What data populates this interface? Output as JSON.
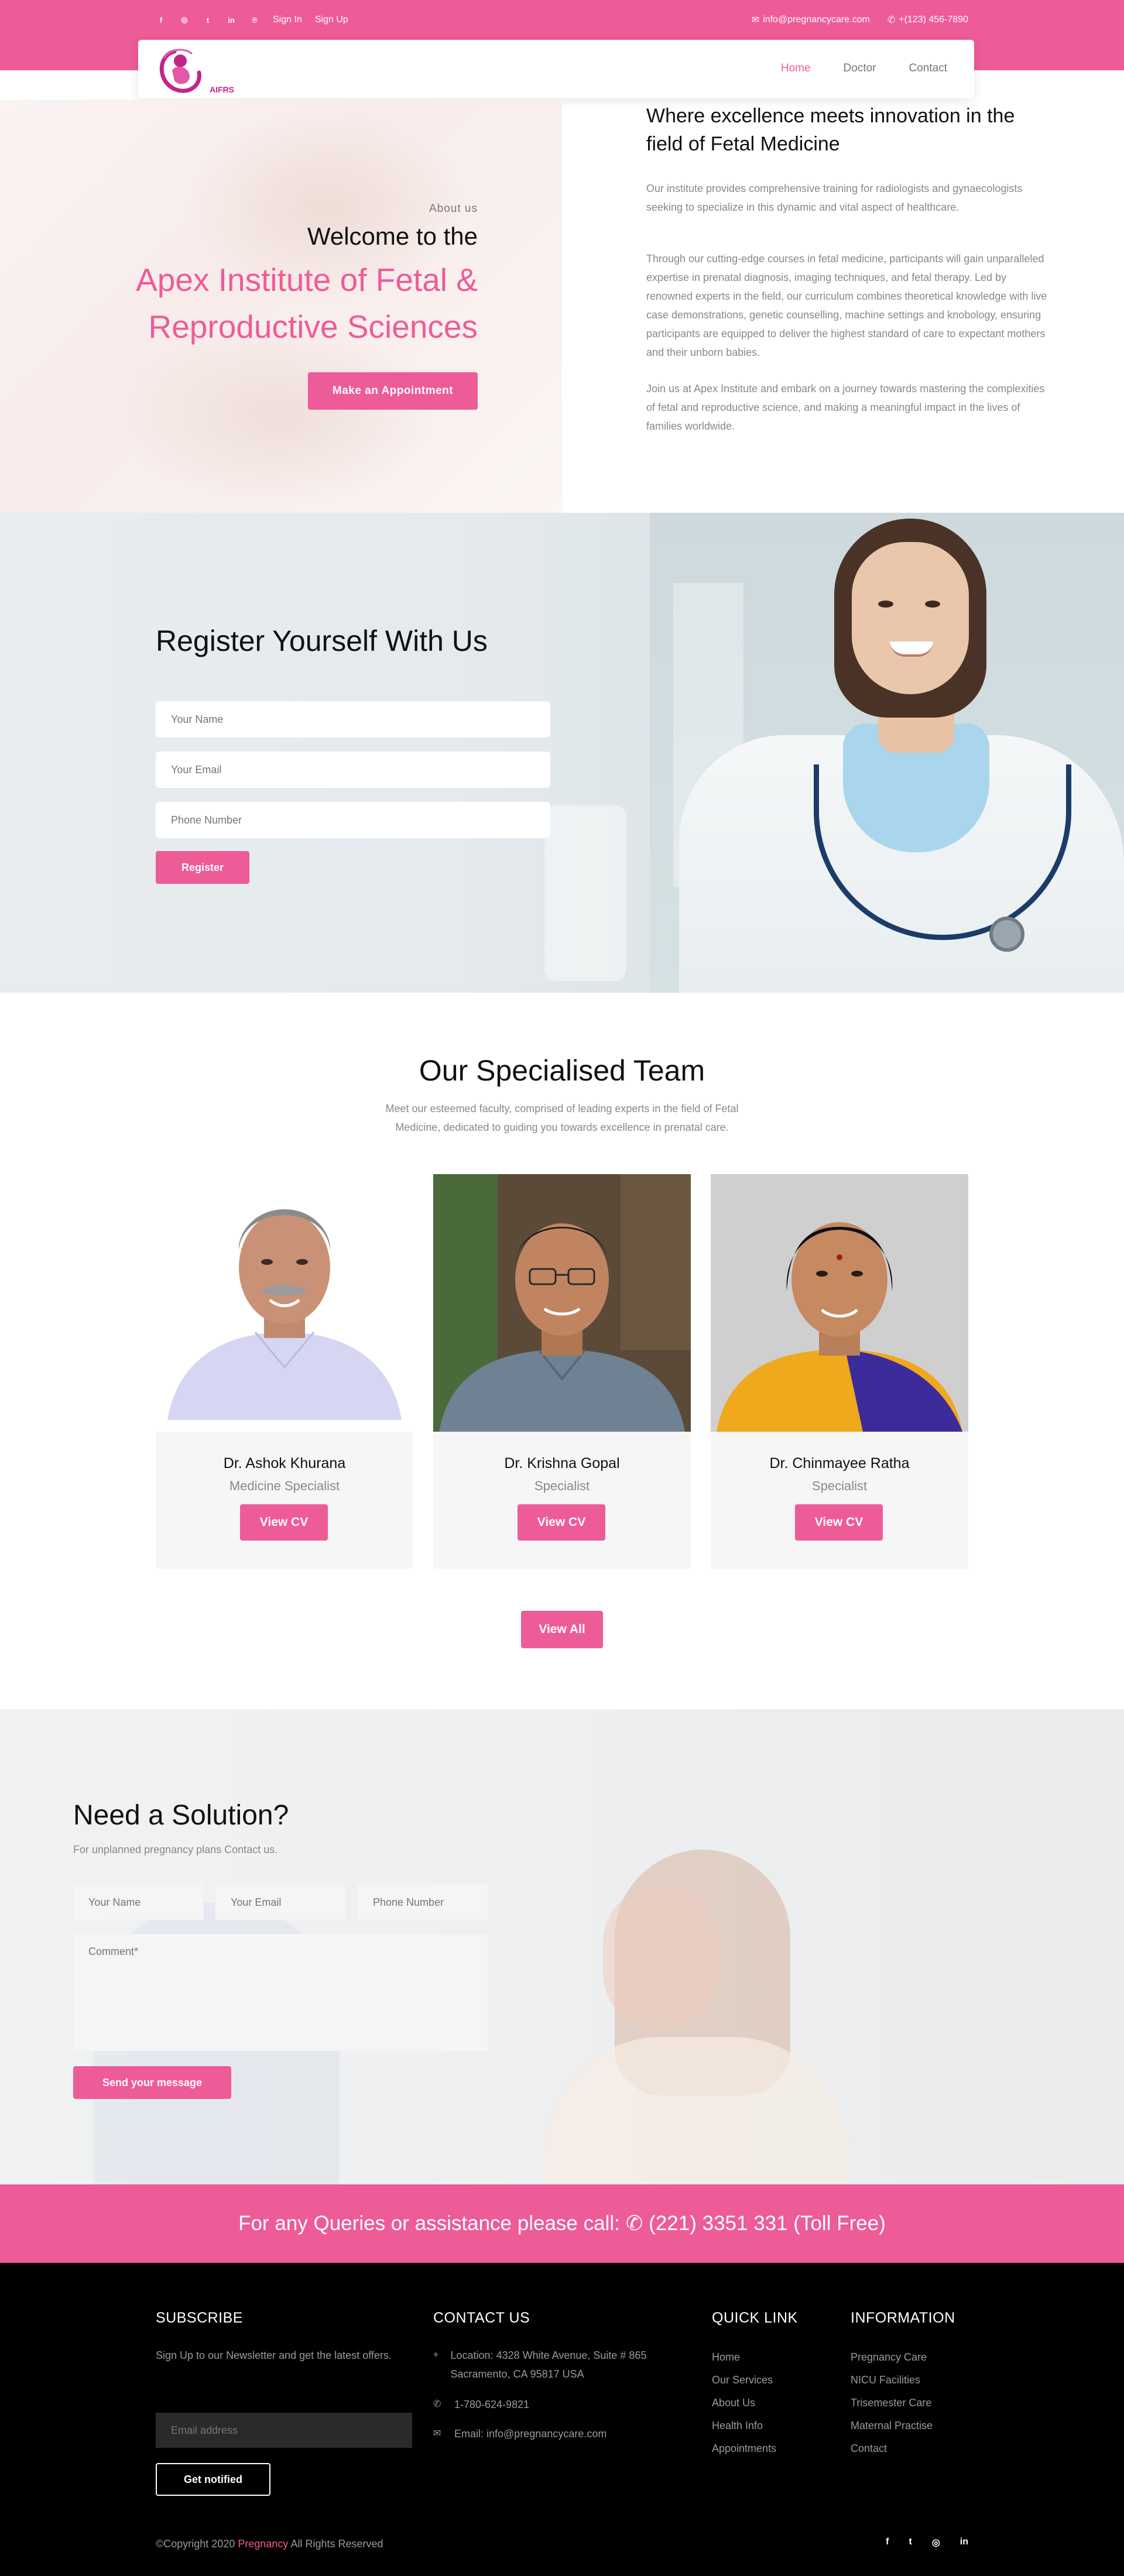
{
  "topbar": {
    "social_icons": [
      "facebook-icon",
      "instagram-icon",
      "twitter-icon",
      "linkedin-icon",
      "pinterest-icon"
    ],
    "social_glyphs": [
      "f",
      "◎",
      "t",
      "in",
      "℗"
    ],
    "sign_in": "Sign In",
    "sign_up": "Sign Up",
    "email": "info@pregnancycare.com",
    "phone": "+(123) 456-7890"
  },
  "nav": {
    "logo_text": "AIFRS",
    "items": [
      "Home",
      "Doctor",
      "Contact"
    ],
    "active_index": 0
  },
  "about": {
    "eyebrow": "About us",
    "welcome": "Welcome to the",
    "title": "Apex Institute of Fetal & Reproductive Sciences",
    "cta": "Make an Appointment",
    "heading": "Where excellence meets innovation in the field of Fetal Medicine",
    "paragraphs": [
      "Our institute provides comprehensive training for radiologists and gynaecologists seeking to specialize in this dynamic and vital aspect of healthcare.",
      "Through our cutting-edge courses in fetal medicine, participants will gain unparalleled expertise in prenatal diagnosis, imaging techniques, and fetal therapy. Led by renowned experts in the field, our curriculum combines theoretical knowledge with live case demonstrations, genetic counselling, machine settings and knobology, ensuring participants are equipped to deliver the highest standard of care to expectant mothers and their unborn babies.",
      "Join us at Apex Institute and embark on a journey towards mastering the complexities of fetal and reproductive science, and making a meaningful impact in the lives of families worldwide."
    ]
  },
  "register": {
    "title": "Register Yourself With Us",
    "name_placeholder": "Your Name",
    "email_placeholder": "Your Email",
    "phone_placeholder": "Phone Number",
    "button": "Register"
  },
  "team": {
    "title": "Our Specialised Team",
    "subtitle": "Meet our esteemed faculty, comprised of leading experts in the field of Fetal Medicine, dedicated to guiding you towards excellence in prenatal care.",
    "members": [
      {
        "name": "Dr. Ashok Khurana",
        "role": "Medicine Specialist",
        "button": "View CV"
      },
      {
        "name": "Dr. Krishna Gopal",
        "role": "Specialist",
        "button": "View CV"
      },
      {
        "name": "Dr. Chinmayee Ratha",
        "role": "Specialist",
        "button": "View CV"
      }
    ],
    "view_all": "View All"
  },
  "solution": {
    "title": "Need a Solution?",
    "subtitle": "For unplanned pregnancy plans Contact us.",
    "name_placeholder": "Your Name",
    "email_placeholder": "Your Email",
    "phone_placeholder": "Phone Number",
    "comment_placeholder": "Comment*",
    "button": "Send your message"
  },
  "callbar": {
    "text": "For any Queries or assistance please call:",
    "phone": "(221) 3351 331 (Toll Free)"
  },
  "footer": {
    "subscribe": {
      "heading": "SUBSCRIBE",
      "text": "Sign Up to our Newsletter and get the latest offers.",
      "email_placeholder": "Email address",
      "button": "Get notified"
    },
    "contact": {
      "heading": "CONTACT US",
      "location": "Location: 4328 White Avenue, Suite # 865 Sacramento, CA 95817 USA",
      "phone": "1-780-624-9821",
      "email": "Email: info@pregnancycare.com"
    },
    "quick_link": {
      "heading": "QUICK LINK",
      "items": [
        "Home",
        "Our Services",
        "About Us",
        "Health Info",
        "Appointments"
      ]
    },
    "information": {
      "heading": "INFORMATION",
      "items": [
        "Pregnancy Care",
        "NICU Facilities",
        "Trisemester Care",
        "Maternal Practise",
        "Contact"
      ]
    },
    "copyright_prefix": "©Copyright 2020",
    "copyright_brand": "Pregnancy",
    "copyright_suffix": "All Rights Reserved",
    "social_icons": [
      "facebook-icon",
      "twitter-icon",
      "instagram-icon",
      "linkedin-icon"
    ],
    "social_glyphs": [
      "f",
      "t",
      "◎",
      "in"
    ]
  },
  "colors": {
    "accent": "#ee5b99",
    "footer_bg": "#000000"
  }
}
